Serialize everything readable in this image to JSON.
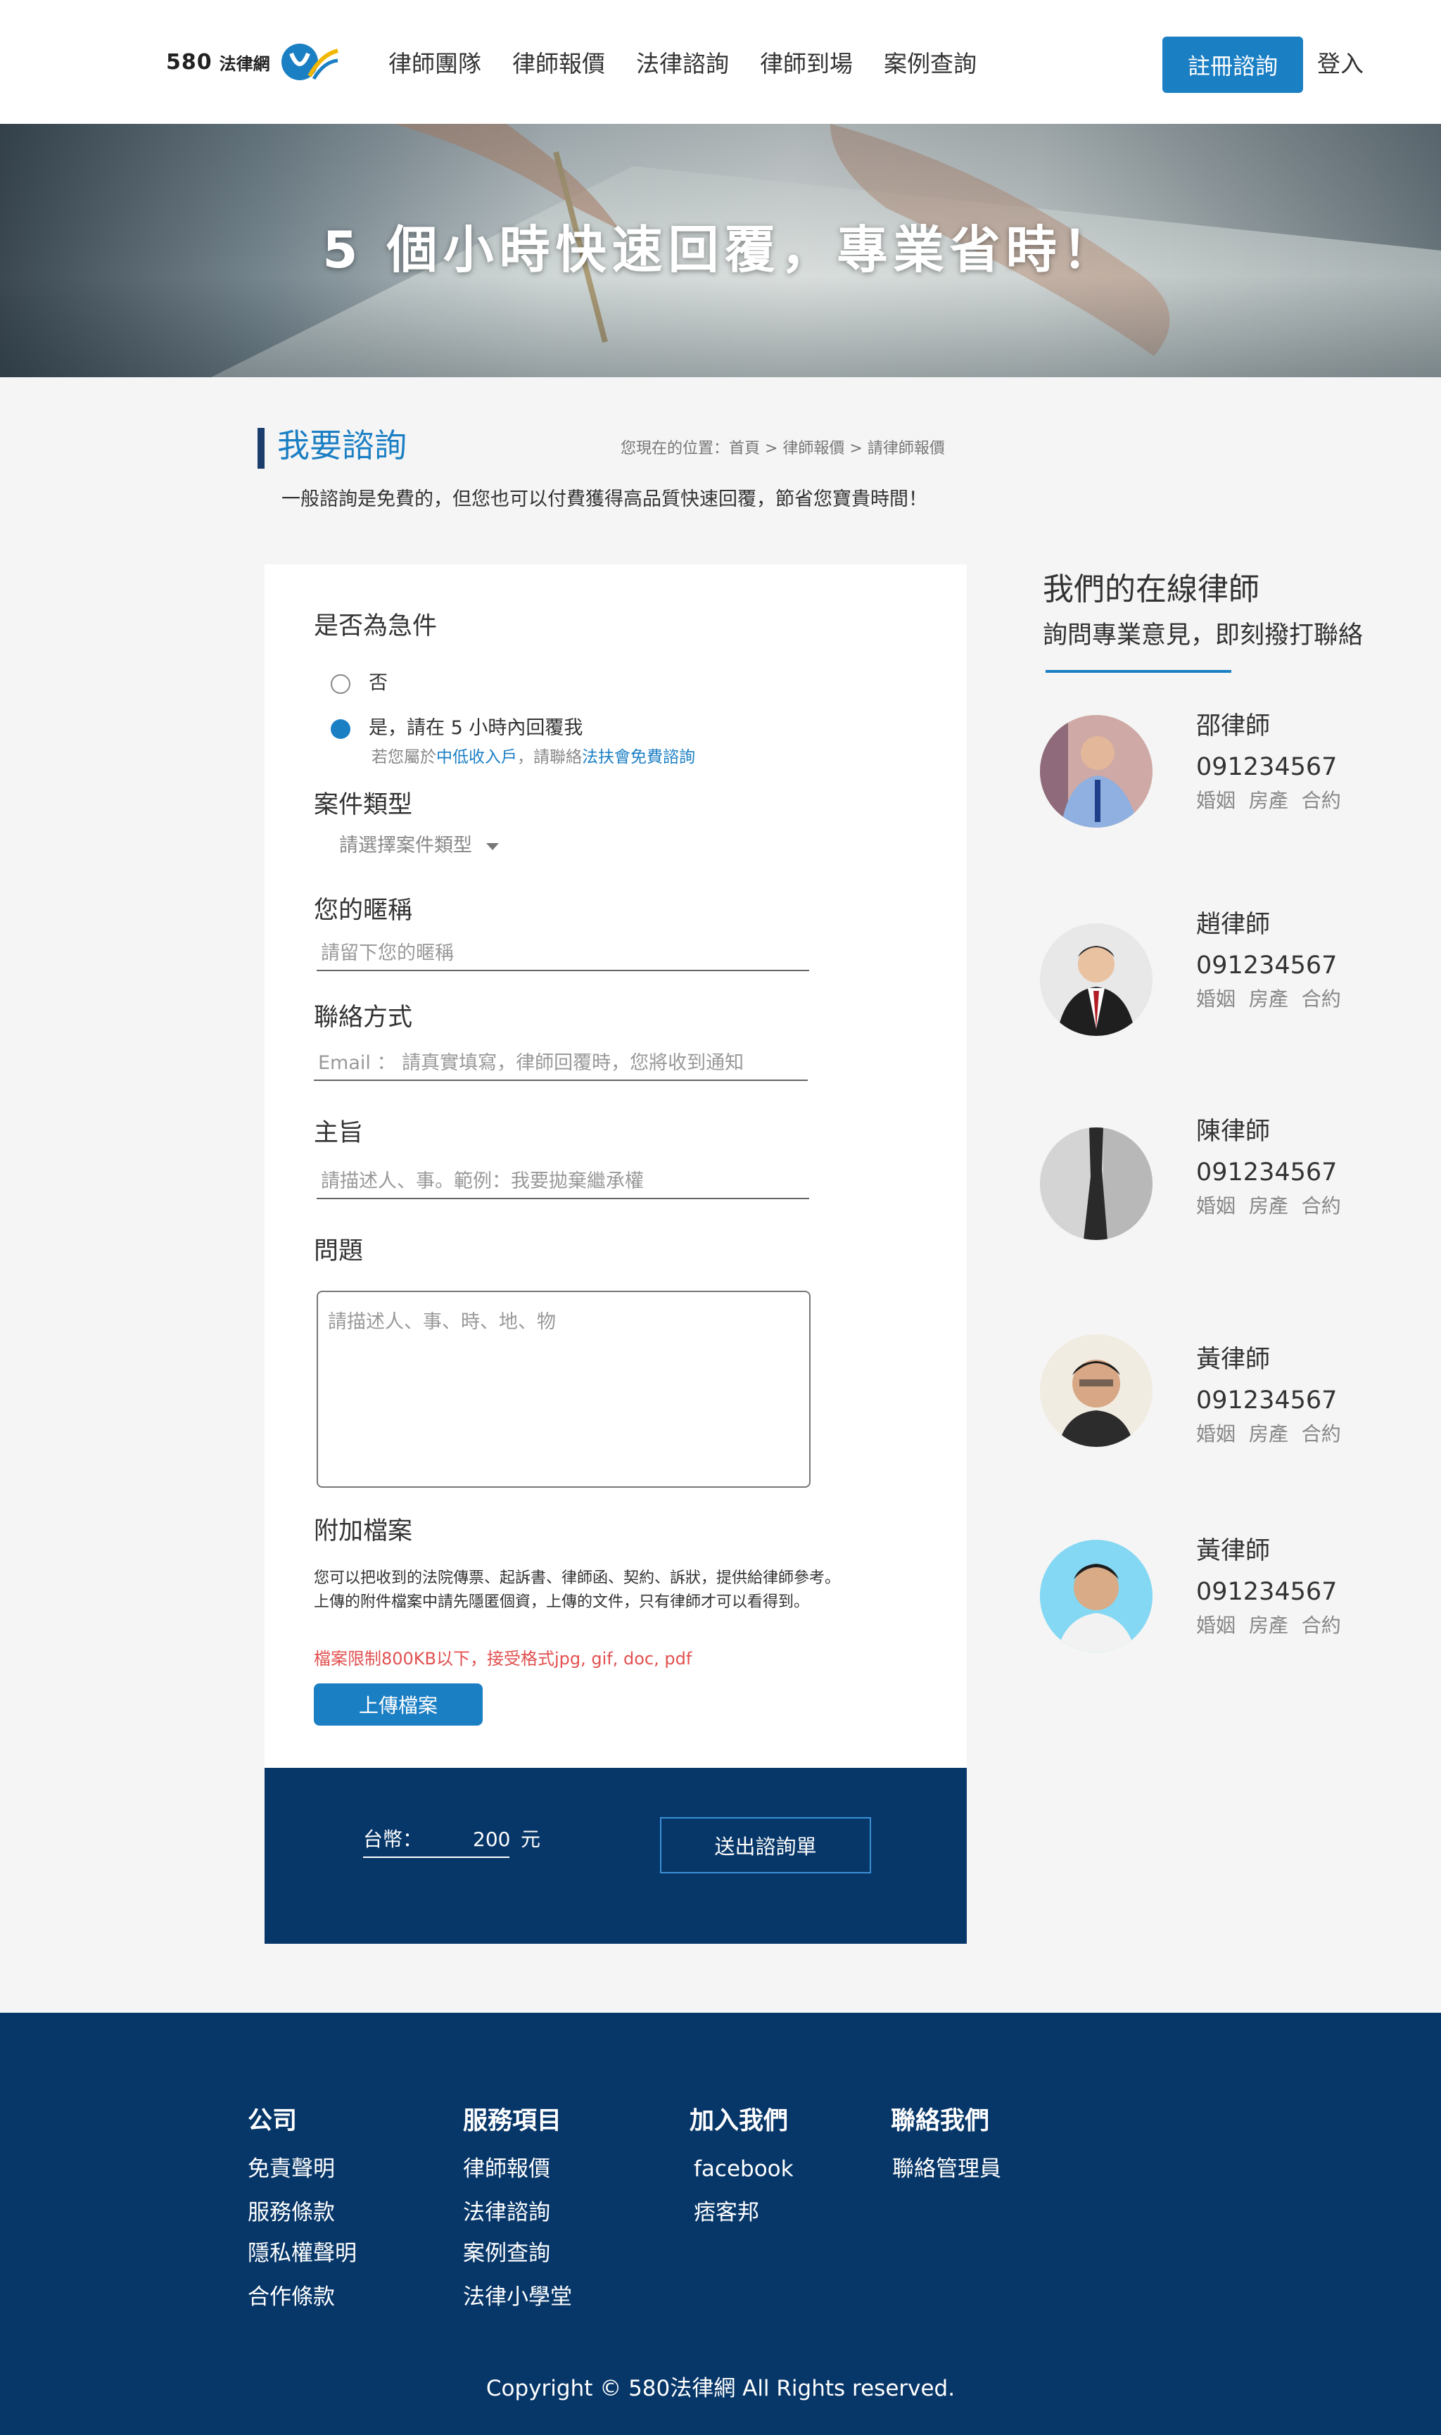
{
  "header": {
    "logo_number": "580",
    "logo_name": "法律網",
    "nav": [
      "律師團隊",
      "律師報價",
      "法律諮詢",
      "律師到場",
      "案例查詢"
    ],
    "register": "註冊諮詢",
    "login": "登入"
  },
  "banner": {
    "title": "5 個小時快速回覆，專業省時！"
  },
  "section": {
    "title": "我要諮詢",
    "breadcrumb": "您現在的位置：首頁 > 律師報價 > 請律師報價",
    "intro": "一般諮詢是免費的，但您也可以付費獲得高品質快速回覆，節省您寶貴時間！"
  },
  "form": {
    "urgent_label": "是否為急件",
    "urgent_options": [
      "否",
      "是，請在 5 小時內回覆我"
    ],
    "urgent_selected": 1,
    "hint_prefix": "若您屬於",
    "hint_link1": "中低收入戶",
    "hint_mid": "，請聯絡",
    "hint_link2": "法扶會免費諮詢",
    "case_type_label": "案件類型",
    "case_type_value": "請選擇案件類型",
    "nickname_label": "您的暱稱",
    "nickname_placeholder": "請留下您的暱稱",
    "contact_label": "聯絡方式",
    "contact_placeholder": "Email ： 請真實填寫，律師回覆時，您將收到通知",
    "subject_label": "主旨",
    "subject_placeholder": "請描述人、事。範例：我要拋棄繼承權",
    "question_label": "問題",
    "question_placeholder": "請描述人、事、時、地、物",
    "attach_label": "附加檔案",
    "attach_desc1": "您可以把收到的法院傳票、起訴書、律師函、契約、訴狀，提供給律師參考。",
    "attach_desc2": "上傳的附件檔案中請先隱匿個資，上傳的文件，只有律師才可以看得到。",
    "attach_limit": "檔案限制800KB以下，接受格式jpg, gif, doc, pdf",
    "upload_button": "上傳檔案"
  },
  "payment": {
    "currency_label": "台幣：",
    "amount": "200",
    "unit": "元",
    "submit": "送出諮詢單"
  },
  "lawyers": {
    "title": "我們的在線律師",
    "subtitle": "詢問專業意見，即刻撥打聯絡",
    "list": [
      {
        "name": "邵律師",
        "phone": "091234567",
        "tags": "婚姻 房產 合約"
      },
      {
        "name": "趙律師",
        "phone": "091234567",
        "tags": "婚姻 房產 合約"
      },
      {
        "name": "陳律師",
        "phone": "091234567",
        "tags": "婚姻 房產 合約"
      },
      {
        "name": "黃律師",
        "phone": "091234567",
        "tags": "婚姻 房產 合約"
      },
      {
        "name": "黃律師",
        "phone": "091234567",
        "tags": "婚姻 房產 合約"
      }
    ]
  },
  "footer": {
    "columns": [
      {
        "title": "公司",
        "links": [
          "免責聲明",
          "服務條款",
          "隱私權聲明",
          "合作條款"
        ]
      },
      {
        "title": "服務項目",
        "links": [
          "律師報價",
          "法律諮詢",
          "案例查詢",
          "法律小學堂"
        ]
      },
      {
        "title": "加入我們",
        "links": [
          "facebook",
          "痞客邦"
        ]
      },
      {
        "title": "聯絡我們",
        "links": [
          "聯絡管理員"
        ]
      }
    ],
    "copyright": "Copyright ©  580法律網  All Rights reserved."
  },
  "colors": {
    "primary": "#1b7fc4",
    "navy": "#073769",
    "warning": "#e25050"
  }
}
